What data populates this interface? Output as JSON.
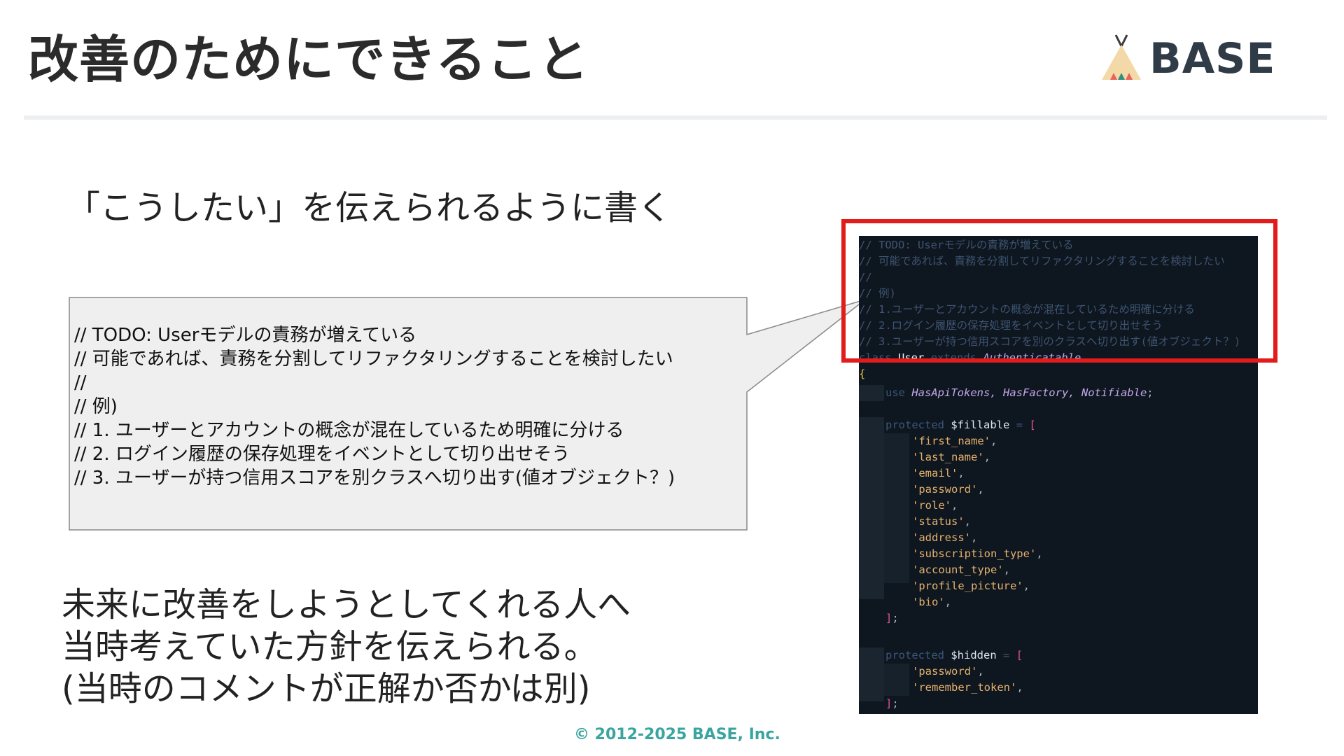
{
  "slide": {
    "title": "改善のためにできること",
    "subtitle": "「こうしたい」を伝えられるように書く",
    "conclusion": [
      "未来に改善をしようとしてくれる人へ",
      "当時考えていた方針を伝えられる。",
      "(当時のコメントが正解か否かは別)"
    ],
    "copyright": "© 2012-2025 BASE, Inc."
  },
  "logo": {
    "text": "BASE",
    "icon": "tent-icon"
  },
  "callout": {
    "lines": [
      "// TODO: Userモデルの責務が増えている",
      "// 可能であれば、責務を分割してリファクタリングすることを検討したい",
      "//",
      "// 例)",
      "// 1. ユーザーとアカウントの概念が混在しているため明確に分ける",
      "// 2. ログイン履歴の保存処理をイベントとして切り出せそう",
      "// 3. ユーザーが持つ信用スコアを別クラスへ切り出す(値オブジェクト？)"
    ]
  },
  "code": {
    "comments": [
      "// TODO: Userモデルの責務が増えている",
      "// 可能であれば、責務を分割してリファクタリングすることを検討したい",
      "//",
      "// 例)",
      "// 1.ユーザーとアカウントの概念が混在しているため明確に分ける",
      "// 2.ログイン履歴の保存処理をイベントとして切り出せそう",
      "// 3.ユーザーが持つ信用スコアを別のクラスへ切り出す(値オブジェクト？)"
    ],
    "class_keyword": "class",
    "class_name": "User",
    "extends_keyword": "extends",
    "parent_class": "Authenticatable",
    "open_brace": "{",
    "use_keyword": "use",
    "traits": "HasApiTokens, HasFactory, Notifiable",
    "semicolon": ";",
    "protected_keyword": "protected",
    "fillable_var": "$fillable",
    "hidden_var": "$hidden",
    "assign": "=",
    "open_bracket": "[",
    "close_bracket": "]",
    "fillable_items": [
      "'first_name'",
      "'last_name'",
      "'email'",
      "'password'",
      "'role'",
      "'status'",
      "'address'",
      "'subscription_type'",
      "'account_type'",
      "'profile_picture'",
      "'bio'"
    ],
    "hidden_items": [
      "'password'",
      "'remember_token'"
    ],
    "comma": ","
  },
  "colors": {
    "highlight": "#e21b1b",
    "code_background": "#0e1620",
    "callout_fill": "#efefef",
    "copyright": "#3aa5a0"
  }
}
